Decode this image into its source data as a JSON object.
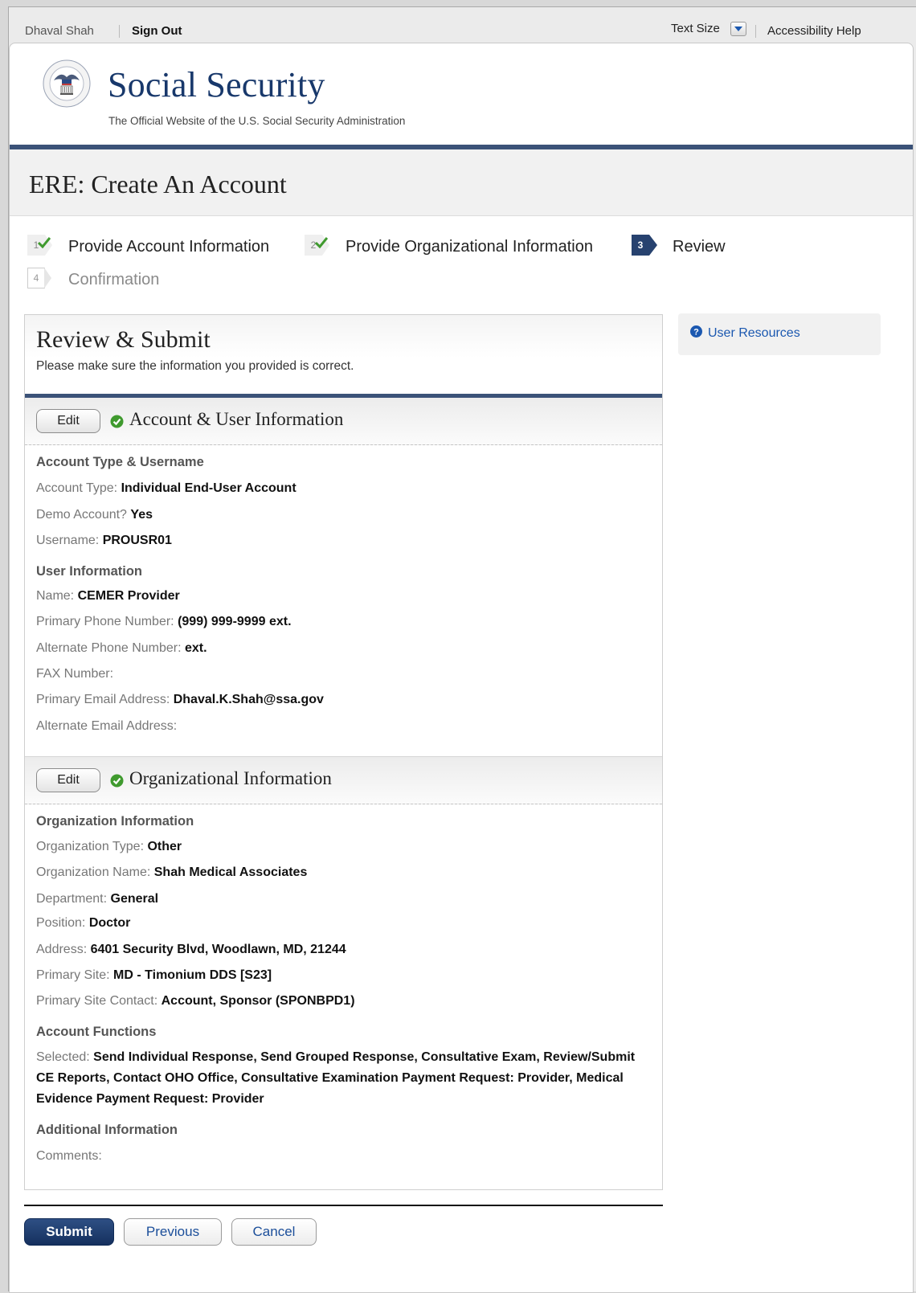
{
  "utility": {
    "user_name": "Dhaval Shah",
    "sign_out": "Sign Out",
    "text_size": "Text Size",
    "accessibility_help": "Accessibility Help"
  },
  "header": {
    "site_title": "Social Security",
    "tagline": "The Official Website of the U.S. Social Security Administration"
  },
  "page": {
    "title": "ERE: Create An Account"
  },
  "steps": [
    {
      "number": "1",
      "label": "Provide Account Information",
      "state": "done"
    },
    {
      "number": "2",
      "label": "Provide Organizational Information",
      "state": "done"
    },
    {
      "number": "3",
      "label": "Review",
      "state": "current"
    },
    {
      "number": "4",
      "label": "Confirmation",
      "state": "future"
    }
  ],
  "review": {
    "title": "Review & Submit",
    "subtitle": "Please make sure the information you provided is correct."
  },
  "account_section": {
    "edit_label": "Edit",
    "title": "Account & User Information",
    "group1": "Account Type & Username",
    "account_type_label": "Account Type:",
    "account_type_value": "Individual End-User Account",
    "demo_label": "Demo Account?",
    "demo_value": "Yes",
    "username_label": "Username:",
    "username_value": "PROUSR01",
    "group2": "User Information",
    "name_label": "Name:",
    "name_value": "CEMER Provider",
    "primary_phone_label": "Primary Phone Number:",
    "primary_phone_value": "(999) 999-9999 ext.",
    "alt_phone_label": "Alternate Phone Number:",
    "alt_phone_value": "ext.",
    "fax_label": "FAX Number:",
    "fax_value": "",
    "primary_email_label": "Primary Email Address:",
    "primary_email_value": "Dhaval.K.Shah@ssa.gov",
    "alt_email_label": "Alternate Email Address:",
    "alt_email_value": ""
  },
  "org_section": {
    "edit_label": "Edit",
    "title": "Organizational Information",
    "group1": "Organization Information",
    "org_type_label": "Organization Type:",
    "org_type_value": "Other",
    "org_name_label": "Organization Name:",
    "org_name_value": "Shah Medical Associates",
    "department_label": "Department:",
    "department_value": "General",
    "position_label": "Position:",
    "position_value": "Doctor",
    "address_label": "Address:",
    "address_value": "6401 Security Blvd, Woodlawn, MD, 21244",
    "primary_site_label": "Primary Site:",
    "primary_site_value": "MD - Timonium DDS [S23]",
    "site_contact_label": "Primary Site Contact:",
    "site_contact_value": "Account, Sponsor (SPONBPD1)",
    "group2": "Account Functions",
    "selected_label": "Selected:",
    "selected_value": "Send Individual Response, Send Grouped Response, Consultative Exam, Review/Submit CE Reports, Contact OHO Office, Consultative Examination Payment Request: Provider, Medical Evidence Payment Request: Provider",
    "group3": "Additional Information",
    "comments_label": "Comments:",
    "comments_value": ""
  },
  "sidebar": {
    "user_resources": "User Resources"
  },
  "actions": {
    "submit": "Submit",
    "previous": "Previous",
    "cancel": "Cancel"
  },
  "colors": {
    "navy": "#27426f",
    "rule": "#3b5278",
    "link": "#1b58b0",
    "ok_green": "#3f9a2e"
  }
}
